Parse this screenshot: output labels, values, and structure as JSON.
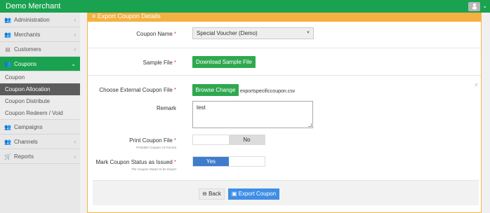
{
  "app": {
    "title": "Demo Merchant"
  },
  "sidebar": {
    "items": [
      {
        "label": "Administration",
        "icon": "users-icon",
        "chevron": "‹"
      },
      {
        "label": "Merchants",
        "icon": "users-icon",
        "chevron": "‹"
      },
      {
        "label": "Customers",
        "icon": "id-card-icon",
        "chevron": "‹"
      },
      {
        "label": "Coupons",
        "icon": "users-icon",
        "chevron": "⌄"
      },
      {
        "label": "Campaigns",
        "icon": "users-icon",
        "chevron": ""
      },
      {
        "label": "Channels",
        "icon": "users-icon",
        "chevron": "‹"
      },
      {
        "label": "Reports",
        "icon": "cart-icon",
        "chevron": "‹"
      }
    ],
    "coupon_sub": [
      "Coupon",
      "Coupon Allocation",
      "Coupon Distribute",
      "Coupon Redeem / Void"
    ]
  },
  "form": {
    "header": "≡ Export Coupon Details",
    "coupon_name_label": "Coupon Name",
    "coupon_name_value": "Special Voucher (Demo)",
    "sample_file_label": "Sample File",
    "download_button": "Download Sample File",
    "choose_file_label": "Choose External Coupon File",
    "browse_button": "Browse Change",
    "file_name": "exportspecificcoupon.csv",
    "remark_label": "Remark",
    "remark_value": "test",
    "print_label": "Print Coupon File",
    "print_hint": "Printable Coupon A4 Format",
    "print_value": "No",
    "mark_label": "Mark Coupon Status as Issued",
    "mark_hint": "The Coupon Status to be Export",
    "mark_value": "Yes",
    "required_mark": "*",
    "close": "×"
  },
  "footer": {
    "back_button": "Back",
    "export_button": "Export Coupon"
  },
  "colors": {
    "brand": "#1aa250",
    "header": "#f5b042",
    "primary": "#3e8fe6",
    "toggle_on": "#3d7dcb"
  }
}
